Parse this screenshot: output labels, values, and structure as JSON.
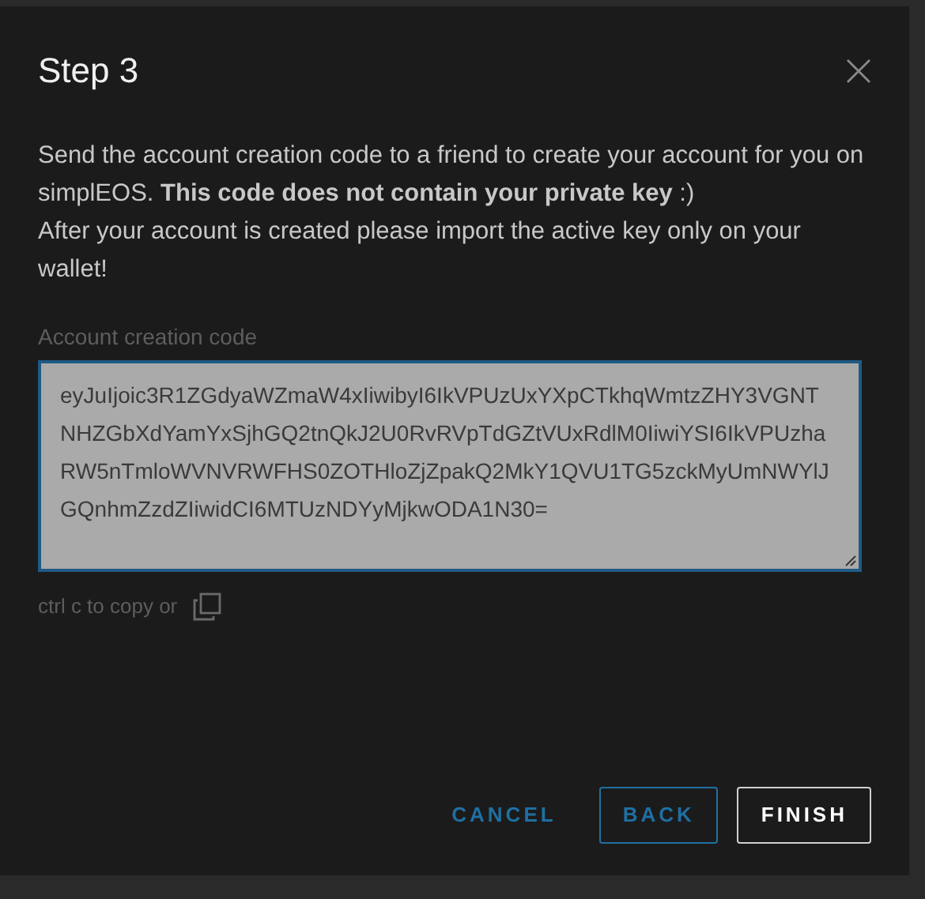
{
  "dialog": {
    "title": "Step 3",
    "message": "Send the account creation code to a friend to create your account for you on simplEOS. **This code does not contain your private key** :)",
    "note": "After your account is created please import the active key only on your wallet!",
    "field": {
      "label": "Account creation code",
      "value": "eyJuIjoic3R1ZGdyaWZmaW4xIiwibyI6IkVPUzUxYXpCTkhqWmtzZHY3VGNTNHZGbXdYamYxSjhGQ2tnQkJ2U0RvRVpTdGZtVUxRdlM0IiwiYSI6IkVPUzhaRW5nTmloWVNVRWFHS0ZOTHloZjZpakQ2MkY1QVU1TG5zckMyUmNWYlJGQnhmZzdZIiwidCI6MTUzNDYyMjkwODA1N30="
    },
    "copy_hint": "ctrl c to copy or",
    "buttons": [
      {
        "label": "CANCEL",
        "kind": "flat"
      },
      {
        "label": "BACK",
        "kind": "outline"
      },
      {
        "label": "FINISH",
        "kind": "primary"
      }
    ]
  }
}
